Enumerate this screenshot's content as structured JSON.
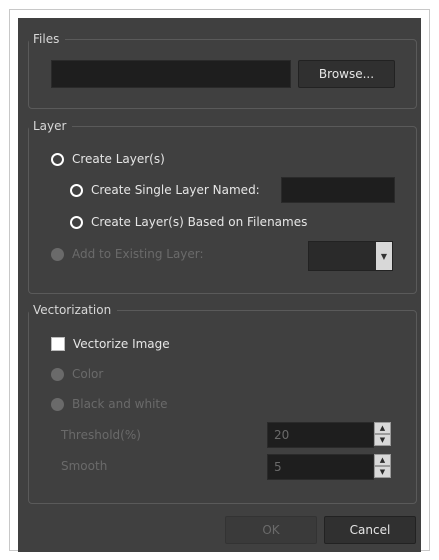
{
  "files": {
    "title": "Files",
    "path_value": "",
    "browse_label": "Browse..."
  },
  "layer": {
    "title": "Layer",
    "create_layers_label": "Create Layer(s)",
    "create_single_label": "Create Single Layer Named:",
    "single_name_value": "",
    "create_based_label": "Create Layer(s) Based on Filenames",
    "add_existing_label": "Add to Existing Layer:",
    "existing_value": ""
  },
  "vectorization": {
    "title": "Vectorization",
    "vectorize_label": "Vectorize Image",
    "color_label": "Color",
    "bw_label": "Black and white",
    "threshold_label": "Threshold(%)",
    "threshold_value": "20",
    "smooth_label": "Smooth",
    "smooth_value": "5"
  },
  "actions": {
    "ok_label": "OK",
    "cancel_label": "Cancel"
  },
  "icons": {
    "spin_up": "up-arrow-icon",
    "spin_down": "down-arrow-icon",
    "combo_arrow": "chevron-down-icon"
  }
}
